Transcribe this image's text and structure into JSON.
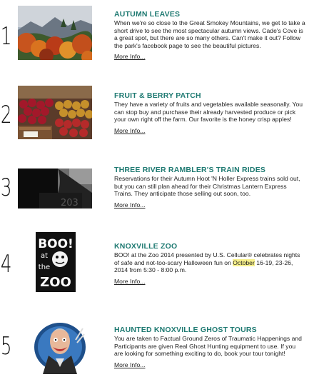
{
  "items": [
    {
      "number": "1",
      "title": "AUTUMN LEAVES",
      "description": "When we're so close to the Great Smokey Mountains, we get to take a short drive to see the most spectacular autumn views. Cade's Cove is a great spot, but there are so many others. Can't make it out? Follow the park's facebook page to see the beautiful pictures.",
      "link": "More Info..."
    },
    {
      "number": "2",
      "title": "FRUIT & BERRY PATCH",
      "description": "They have a variety of fruits and vegetables available seasonally. You can stop buy and purchase their already harvested produce or pick your own right off the farm. Our favorite is the honey crisp apples!",
      "link": "More Info..."
    },
    {
      "number": "3",
      "title": "THREE RIVER RAMBLER'S TRAIN RIDES",
      "description": "Reservations for their Autumn Hoot 'N Holler Express trains sold out, but you can still plan ahead for their Christmas Lantern Express Trains. They anticipate those selling out soon, too.",
      "link": "More Info...",
      "train_number": "203"
    },
    {
      "number": "4",
      "title": "KNOXVILLE ZOO",
      "description_before": "BOO! at the Zoo 2014 presented by U.S. Cellular® celebrates nights of safe and not-too-scary Halloween fun on ",
      "description_highlight": "October",
      "description_after": " 16-19, 23-26, 2014 from 5:30 - 8:00 p.m.",
      "link": "More Info...",
      "logo": {
        "line1": "BOO!",
        "line2": "at",
        "line3": "the",
        "line4": "ZOO"
      }
    },
    {
      "number": "5",
      "title": "HAUNTED KNOXVILLE GHOST TOURS",
      "description": "You are taken to Factual Ground Zeros of Traumatic Happenings and Participants are given Real Ghost Hunting equipment to use. If you are looking for something exciting to do, book your tour tonight!",
      "link": "More Info..."
    }
  ],
  "colors": {
    "title": "#1f7a72",
    "highlight": "#f7f08a"
  }
}
